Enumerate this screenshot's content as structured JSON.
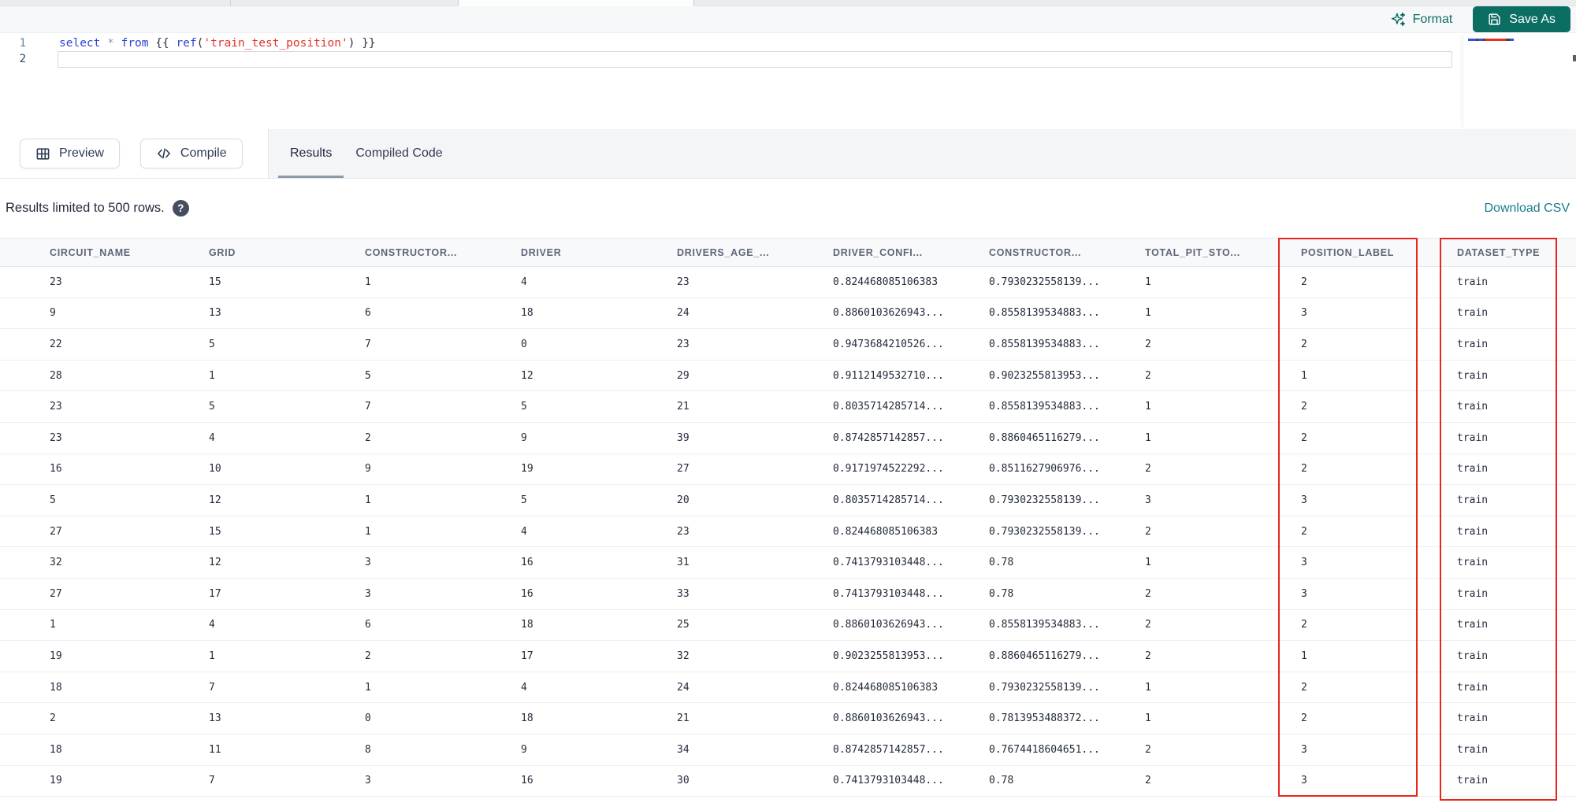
{
  "toolbar": {
    "format_label": "Format",
    "save_as_label": "Save As"
  },
  "editor": {
    "line_numbers": [
      "1",
      "2"
    ],
    "code_segments": [
      {
        "text": "select",
        "type": "kw"
      },
      {
        "text": " ",
        "type": "pl"
      },
      {
        "text": "*",
        "type": "op"
      },
      {
        "text": " ",
        "type": "pl"
      },
      {
        "text": "from",
        "type": "kw"
      },
      {
        "text": " ",
        "type": "pl"
      },
      {
        "text": "{{",
        "type": "br"
      },
      {
        "text": " ",
        "type": "pl"
      },
      {
        "text": "ref",
        "type": "fn"
      },
      {
        "text": "(",
        "type": "pn"
      },
      {
        "text": "'train_test_position'",
        "type": "str"
      },
      {
        "text": ")",
        "type": "pn"
      },
      {
        "text": " ",
        "type": "pl"
      },
      {
        "text": "}}",
        "type": "br"
      }
    ]
  },
  "actions": {
    "preview_label": "Preview",
    "compile_label": "Compile"
  },
  "results_panel": {
    "tabs": [
      {
        "label": "Results",
        "active": true
      },
      {
        "label": "Compiled Code",
        "active": false
      }
    ],
    "info_text": "Results limited to 500 rows.",
    "help_glyph": "?",
    "download_label": "Download CSV"
  },
  "table": {
    "columns": [
      "CIRCUIT_NAME",
      "GRID",
      "CONSTRUCTOR...",
      "DRIVER",
      "DRIVERS_AGE_...",
      "DRIVER_CONFI...",
      "CONSTRUCTOR...",
      "TOTAL_PIT_STO...",
      "POSITION_LABEL",
      "DATASET_TYPE"
    ],
    "rows": [
      [
        "23",
        "15",
        "1",
        "4",
        "23",
        "0.824468085106383",
        "0.7930232558139...",
        "1",
        "2",
        "train"
      ],
      [
        "9",
        "13",
        "6",
        "18",
        "24",
        "0.8860103626943...",
        "0.8558139534883...",
        "1",
        "3",
        "train"
      ],
      [
        "22",
        "5",
        "7",
        "0",
        "23",
        "0.9473684210526...",
        "0.8558139534883...",
        "2",
        "2",
        "train"
      ],
      [
        "28",
        "1",
        "5",
        "12",
        "29",
        "0.9112149532710...",
        "0.9023255813953...",
        "2",
        "1",
        "train"
      ],
      [
        "23",
        "5",
        "7",
        "5",
        "21",
        "0.8035714285714...",
        "0.8558139534883...",
        "1",
        "2",
        "train"
      ],
      [
        "23",
        "4",
        "2",
        "9",
        "39",
        "0.8742857142857...",
        "0.8860465116279...",
        "1",
        "2",
        "train"
      ],
      [
        "16",
        "10",
        "9",
        "19",
        "27",
        "0.9171974522292...",
        "0.8511627906976...",
        "2",
        "2",
        "train"
      ],
      [
        "5",
        "12",
        "1",
        "5",
        "20",
        "0.8035714285714...",
        "0.7930232558139...",
        "3",
        "3",
        "train"
      ],
      [
        "27",
        "15",
        "1",
        "4",
        "23",
        "0.824468085106383",
        "0.7930232558139...",
        "2",
        "2",
        "train"
      ],
      [
        "32",
        "12",
        "3",
        "16",
        "31",
        "0.7413793103448...",
        "0.78",
        "1",
        "3",
        "train"
      ],
      [
        "27",
        "17",
        "3",
        "16",
        "33",
        "0.7413793103448...",
        "0.78",
        "2",
        "3",
        "train"
      ],
      [
        "1",
        "4",
        "6",
        "18",
        "25",
        "0.8860103626943...",
        "0.8558139534883...",
        "2",
        "2",
        "train"
      ],
      [
        "19",
        "1",
        "2",
        "17",
        "32",
        "0.9023255813953...",
        "0.8860465116279...",
        "2",
        "1",
        "train"
      ],
      [
        "18",
        "7",
        "1",
        "4",
        "24",
        "0.824468085106383",
        "0.7930232558139...",
        "1",
        "2",
        "train"
      ],
      [
        "2",
        "13",
        "0",
        "18",
        "21",
        "0.8860103626943...",
        "0.7813953488372...",
        "1",
        "2",
        "train"
      ],
      [
        "18",
        "11",
        "8",
        "9",
        "34",
        "0.8742857142857...",
        "0.7674418604651...",
        "2",
        "3",
        "train"
      ],
      [
        "19",
        "7",
        "3",
        "16",
        "30",
        "0.7413793103448...",
        "0.78",
        "2",
        "3",
        "train"
      ]
    ],
    "highlighted_columns": [
      "POSITION_LABEL",
      "DATASET_TYPE"
    ]
  },
  "colors": {
    "accent_teal": "#0c6e63",
    "link_teal": "#1b7d8a",
    "highlight_red": "#e8261d",
    "syntax_keyword": "#2d41d8",
    "syntax_string": "#e0342b",
    "syntax_operator": "#8d92bd"
  }
}
